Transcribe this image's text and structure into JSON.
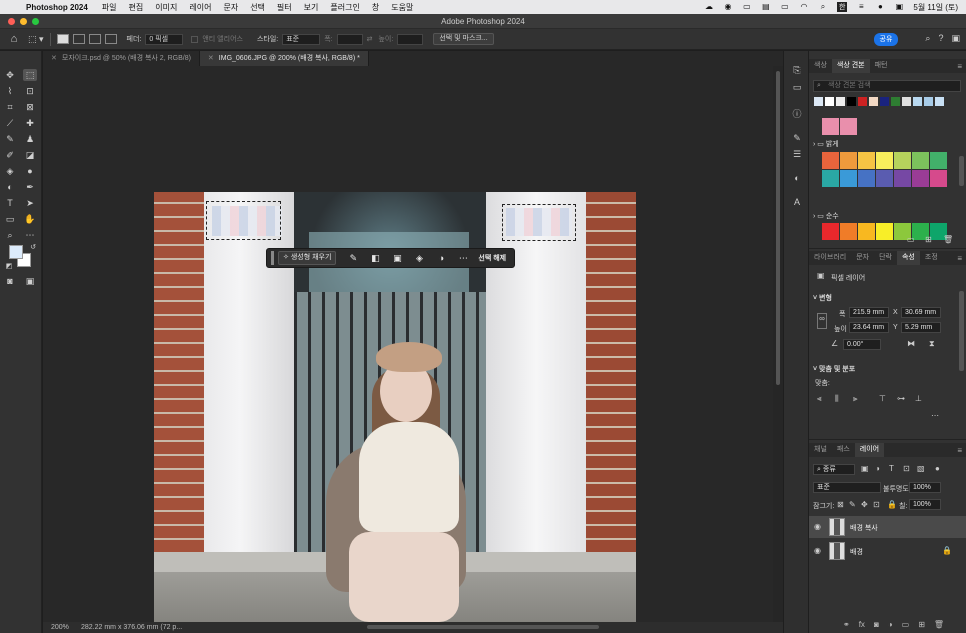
{
  "menubar": {
    "app_name": "Photoshop 2024",
    "items": [
      "파일",
      "편집",
      "이미지",
      "레이어",
      "문자",
      "선택",
      "필터",
      "보기",
      "플러그인",
      "창",
      "도움말"
    ],
    "clock": "5월 11일 (토)",
    "input_method": "한"
  },
  "window": {
    "title": "Adobe Photoshop 2024"
  },
  "options": {
    "feather_label": "페더:",
    "feather_value": "0 픽셀",
    "antialias_label": "앤티 앨리어스",
    "style_label": "스타일:",
    "style_value": "표준",
    "width_label": "폭:",
    "height_label": "높이:",
    "select_mask_button": "선택 및 마스크...",
    "share_button": "공유"
  },
  "tabs": [
    {
      "label": "모자이크.psd @ 50% (배경 복사 2, RGB/8)",
      "active": false
    },
    {
      "label": "IMG_0606.JPG @ 200% (배경 복사, RGB/8) *",
      "active": true
    }
  ],
  "context_bar": {
    "generative_fill": "생성형 채우기",
    "deselect": "선택 해제"
  },
  "status": {
    "zoom": "200%",
    "doc_size": "282.22 mm x 376.06 mm (72 p..."
  },
  "swatches_panel": {
    "tabs": [
      "색상",
      "색상 견본",
      "패턴"
    ],
    "active_tab": 1,
    "search_placeholder": "색상 견본 검색",
    "recent_colors": [
      "#dce8f5",
      "#ffffff",
      "#eeeeee",
      "#000000",
      "#cc2222",
      "#f3d9c4",
      "#1a237e",
      "#2e7d32",
      "#e0e0e0",
      "#b8d8f0",
      "#a8cce8",
      "#c8e0f4"
    ],
    "pink_colors": [
      "#e98fac",
      "#e98fac"
    ],
    "group_bright": "밝게",
    "bright_colors": [
      "#e8643c",
      "#ee9a3c",
      "#f6c444",
      "#f8ee5c",
      "#b6d25c",
      "#7cc25c",
      "#42b06a",
      "#2aa8a4",
      "#3a9ad8",
      "#4672c4",
      "#5a5cb0",
      "#7648a4",
      "#9a3c96",
      "#d64a8c"
    ],
    "group_pure": "순수",
    "pure_colors": [
      "#e8282c",
      "#f07c28",
      "#f8b820",
      "#f8ee28",
      "#8cc83c",
      "#2cb04c",
      "#0ea56a"
    ]
  },
  "properties_panel": {
    "tabs": [
      "라이브러리",
      "문자",
      "단락",
      "속성",
      "조정"
    ],
    "active_tab": 3,
    "layer_type": "픽셀 레이어",
    "transform_title": "변형",
    "w_label": "폭",
    "w_value": "215.9 mm",
    "x_label": "X",
    "x_value": "30.69 mm",
    "h_label": "높이",
    "h_value": "23.64 mm",
    "y_label": "Y",
    "y_value": "5.29 mm",
    "angle_value": "0.00°",
    "align_title": "맞춤 및 분포",
    "align_label": "맞춤:"
  },
  "layers_panel": {
    "tabs": [
      "채널",
      "패스",
      "레이어"
    ],
    "active_tab": 2,
    "kind_filter": "종류",
    "blend_mode": "표준",
    "opacity_label": "불투명도:",
    "opacity_value": "100%",
    "lock_label": "잠그기:",
    "fill_label": "칠:",
    "fill_value": "100%",
    "layers": [
      {
        "name": "배경 복사",
        "selected": true,
        "locked": false
      },
      {
        "name": "배경",
        "selected": false,
        "locked": true
      }
    ]
  },
  "colors": {
    "accent": "#1b73e8",
    "panel_bg": "#323232",
    "canvas_bg": "#282828"
  }
}
